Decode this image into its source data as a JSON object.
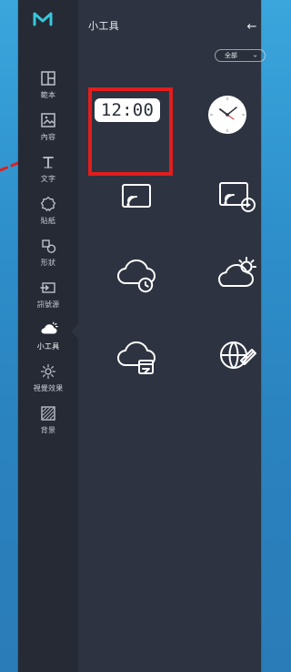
{
  "panel": {
    "title": "小工具",
    "back_arrow_glyph": "←",
    "filter": {
      "selected": "全部",
      "chevron_glyph": "⌄"
    }
  },
  "rail": {
    "items": [
      {
        "id": "layout",
        "label": "範本",
        "icon": "layout-icon",
        "active": false
      },
      {
        "id": "content",
        "label": "內容",
        "icon": "image-icon",
        "active": false
      },
      {
        "id": "text",
        "label": "文字",
        "icon": "text-icon",
        "active": false
      },
      {
        "id": "sticker",
        "label": "貼紙",
        "icon": "sticker-icon",
        "active": false
      },
      {
        "id": "shapes",
        "label": "形狀",
        "icon": "shapes-icon",
        "active": false
      },
      {
        "id": "input-source",
        "label": "訊號源",
        "icon": "input-source-icon",
        "active": false
      },
      {
        "id": "widgets",
        "label": "小工具",
        "icon": "weather-widget-icon",
        "active": true
      },
      {
        "id": "visual-effects",
        "label": "視覺效果",
        "icon": "visual-effects-icon",
        "active": false
      },
      {
        "id": "background",
        "label": "背景",
        "icon": "background-icon",
        "active": false
      }
    ]
  },
  "widgets": {
    "items": [
      {
        "name": "digital-clock",
        "text": "12:00",
        "icon": "digital-clock-icon"
      },
      {
        "name": "analog-clock",
        "icon": "analog-clock-icon"
      },
      {
        "name": "cast",
        "icon": "cast-icon"
      },
      {
        "name": "cast-play",
        "icon": "cast-play-icon"
      },
      {
        "name": "weather-clock",
        "icon": "cloud-clock-icon"
      },
      {
        "name": "weather-sun",
        "icon": "sun-cloud-icon"
      },
      {
        "name": "weather-calendar",
        "icon": "cloud-calendar-icon"
      },
      {
        "name": "web",
        "icon": "globe-link-icon"
      }
    ]
  },
  "colors": {
    "background_top": "#3aa6dc",
    "background_bottom": "#2a7cb8",
    "panel": "#2d3340",
    "rail": "#252a35",
    "logo": "#39c7d9",
    "highlight": "#e21d1d",
    "text": "#e7eaf0"
  }
}
